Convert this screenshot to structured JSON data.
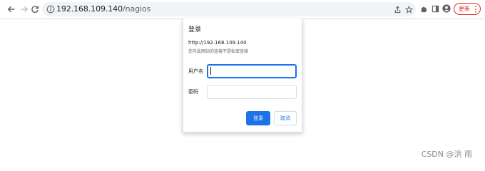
{
  "browser": {
    "address": {
      "host": "192.168.109.140",
      "path": "/nagios"
    },
    "update_button": {
      "label": "更新"
    }
  },
  "icons": {
    "back": "arrow-left-icon",
    "forward": "arrow-right-icon",
    "reload": "reload-icon",
    "site_info": "info-icon",
    "share": "share-icon",
    "bookmark": "star-icon",
    "extensions": "puzzle-icon",
    "side_panel": "side-panel-icon",
    "profile": "avatar-icon",
    "menu": "kebab-menu-icon"
  },
  "colors": {
    "accent": "#1a73e8",
    "update_red": "#d93025",
    "omnibox_bg": "#f1f3f4"
  },
  "dialog": {
    "title": "登录",
    "url": "http://192.168.109.140",
    "warning": "您与此网站的连接不是私密连接",
    "username_label": "用户名",
    "username_value": "",
    "password_label": "密码",
    "password_value": "",
    "login_button": "登录",
    "cancel_button": "取消"
  },
  "watermark": "CSDN @洪 雨"
}
